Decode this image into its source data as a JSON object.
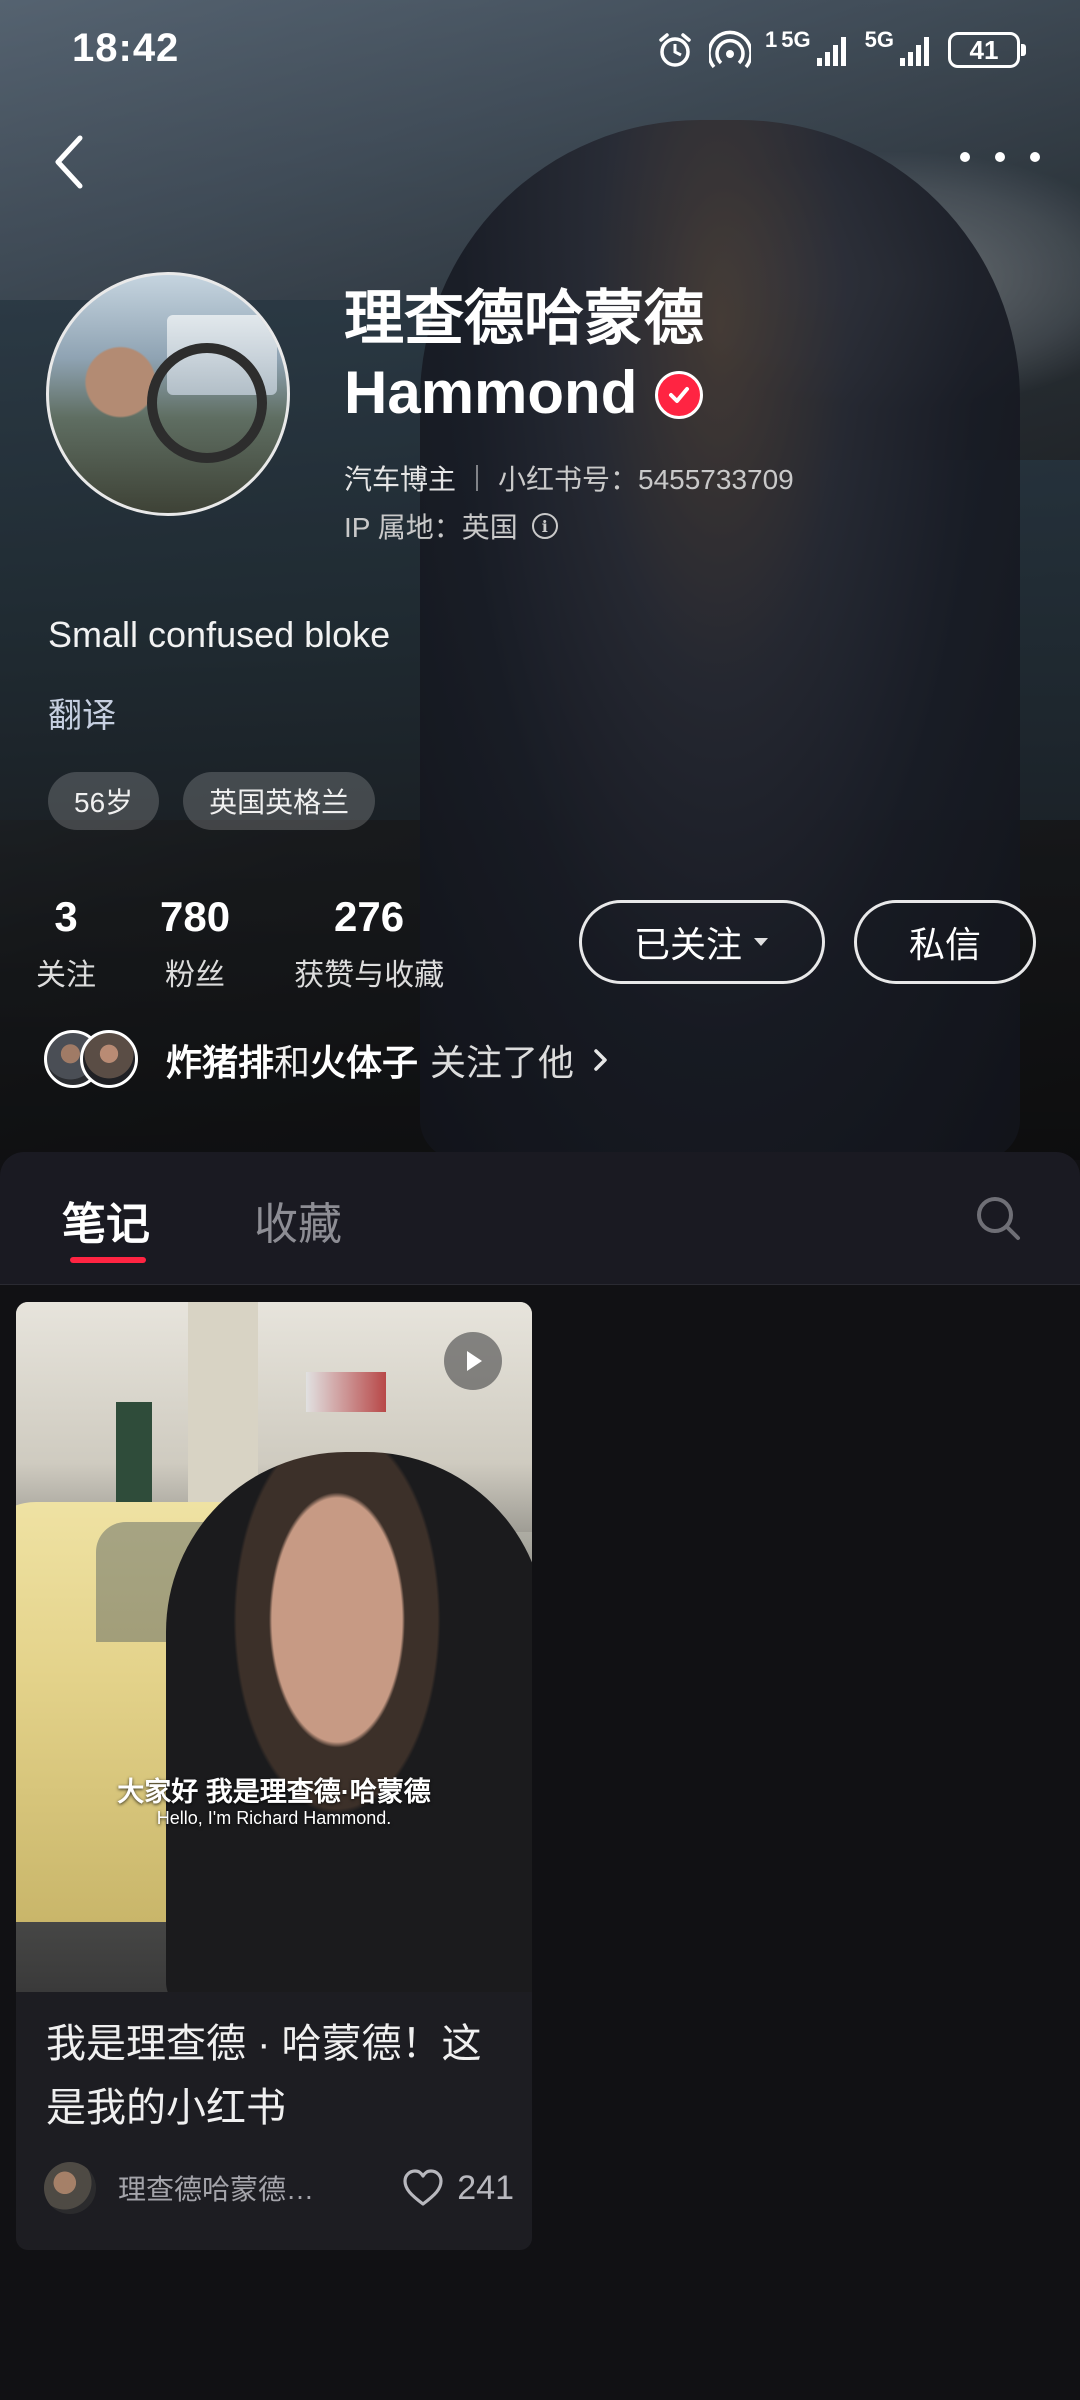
{
  "status_bar": {
    "time": "18:42",
    "signal1_label": "5G",
    "signal2_label": "5G",
    "sim_index": "1",
    "battery": "41",
    "icons": [
      "alarm-icon",
      "hotspot-icon",
      "signal-icon",
      "battery-icon"
    ]
  },
  "nav": {
    "back_icon": "chevron-left-icon",
    "more_icon": "more-dots-icon"
  },
  "profile": {
    "name_line1": "理查德哈蒙德",
    "name_line2": "Hammond",
    "verified_icon": "verified-check-icon",
    "category": "汽车博主",
    "id_text": "小红书号：5455733709",
    "ip_text": "IP 属地：英国",
    "bio": "Small confused bloke",
    "translate": "翻译",
    "tags": [
      "56岁",
      "英国英格兰"
    ],
    "stats": [
      {
        "value": "3",
        "label": "关注"
      },
      {
        "value": "780",
        "label": "粉丝"
      },
      {
        "value": "276",
        "label": "获赞与收藏"
      }
    ],
    "follow_button": "已关注",
    "message_button": "私信",
    "followed_by": {
      "user1": "炸猪排",
      "joiner": "和",
      "user2": "火体子",
      "tail": "关注了他"
    }
  },
  "tabs": {
    "items": [
      "笔记",
      "收藏"
    ],
    "active": "笔记",
    "search_icon": "search-icon"
  },
  "notes": [
    {
      "subtitle_cn": "大家好 我是理查德·哈蒙德",
      "subtitle_en": "Hello, I'm Richard Hammond.",
      "title": "我是理查德 · 哈蒙德！这是我的小红书",
      "author": "理查德哈蒙德…",
      "likes": "241",
      "type_icon": "play-icon"
    }
  ],
  "colors": {
    "accent": "#ff2442",
    "background": "#111114",
    "tab_bar": "#1a1a22"
  }
}
